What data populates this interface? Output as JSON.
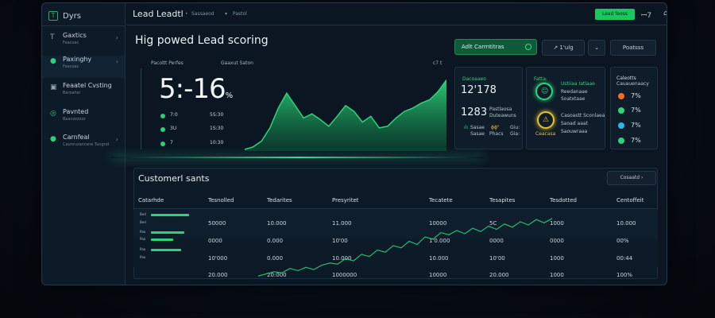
{
  "sidebar": {
    "brand": "Dyrs",
    "brand_icon": "T",
    "items": [
      {
        "label": "Gaxtics",
        "sub": "Feacoac",
        "icon": "T"
      },
      {
        "label": "Paxinghy",
        "sub": "Feacoac",
        "icon": "●"
      },
      {
        "label": "Feaatel Cvsting",
        "sub": "Baroahsr",
        "icon": "▣"
      },
      {
        "label": "Pavnted",
        "sub": "Baanzzzzzz",
        "icon": "◎"
      },
      {
        "label": "Carnfeal",
        "sub": "Caunruzanrane Tungnd",
        "icon": "●"
      }
    ]
  },
  "topbar": {
    "title": "Lead Leadtl",
    "crumb1": "Sassaeod",
    "crumb2": "Pastol",
    "action_button": "Lead feoss",
    "icon_labels": [
      "ꟷ7",
      "⌂",
      "⚙"
    ]
  },
  "main": {
    "title": "Hig powed Lead scoring",
    "btn_primary": "Adlt Carrntitras",
    "btn_secondary": "↗ 1'ulg",
    "btn_chevron": "⌄",
    "btn_options": "Poatsss"
  },
  "stats": {
    "label_left": "Pacoltt Perfes",
    "label_mid": "Gaaxut Saton",
    "label_right": "c7 t",
    "big_value": "5:-16",
    "big_unit": "%",
    "rows": [
      {
        "label": "7:0",
        "value": "5S:30"
      },
      {
        "label": "3U",
        "value": "1S:30"
      },
      {
        "label": "7",
        "value": "10:30"
      }
    ]
  },
  "chart_data": {
    "type": "area",
    "x": [
      0,
      1,
      2,
      3,
      4,
      5,
      6,
      7,
      8,
      9,
      10,
      11,
      12,
      13,
      14,
      15,
      16,
      17,
      18,
      19,
      20,
      21,
      22,
      23,
      24
    ],
    "series": [
      {
        "values": [
          2,
          5,
          12,
          28,
          52,
          70,
          55,
          40,
          45,
          38,
          30,
          42,
          55,
          48,
          35,
          42,
          28,
          30,
          40,
          48,
          52,
          58,
          62,
          72,
          86
        ]
      }
    ],
    "ylim": [
      0,
      100
    ],
    "color": "#2fd37a"
  },
  "panel_score": {
    "label": "Dacoaaeo",
    "big": "12'178",
    "label2": "Pastlaosa",
    "big2": "1283",
    "sub2": "Duteawuns",
    "row_labels": [
      "Sasae",
      "ɸɸ\"",
      "Giu:"
    ],
    "row_vals": [
      "Sasae",
      "Phacs",
      "Gia:"
    ]
  },
  "panel_gauge": {
    "label_top": "Fatta:",
    "icon1": "☺",
    "text1a": "Ustiiaa Iatlaae",
    "text1b": "Reedanaae",
    "text1c": "Soatxtaae",
    "icon2": "⚠",
    "text2a": "Casoastt Sconlaea",
    "text2b": "Saoad aaat",
    "text2c": "Saouwraaa",
    "stamp": "Ceacasa"
  },
  "panel_legend": {
    "title": "Caleotts",
    "subtitle": "Cauauenaacy",
    "items": [
      {
        "value": "7%",
        "color": "#f26b2b"
      },
      {
        "value": "7%",
        "color": "#2fd37a"
      },
      {
        "value": "7%",
        "color": "#29b8f0"
      },
      {
        "value": "7%",
        "color": "#2fd37a"
      }
    ]
  },
  "table": {
    "title": "Customerl sants",
    "filter": "Cosaatd",
    "headers": [
      "Catarhde",
      "Tesnolled",
      "Tedarites",
      "Presyritet",
      "Tecatete",
      "Tesapites",
      "Tesdotted",
      "Centoffeit"
    ],
    "rows": [
      {
        "cells": [
          "50000",
          "10.000",
          "11.000",
          "10000",
          "5C",
          "1000",
          "10.000"
        ],
        "mini": [
          [
            "Bed",
            48
          ],
          [
            "Bed",
            0
          ]
        ]
      },
      {
        "cells": [
          "0000",
          "0.000",
          "10'00",
          "1'0.000",
          "0000",
          "0000",
          "00%"
        ],
        "mini": [
          [
            "Paa",
            42
          ],
          [
            "Paa",
            28
          ]
        ]
      },
      {
        "cells": [
          "10'000",
          "0.000",
          "10.000",
          "10.000",
          "10'00",
          "1000",
          "00:44"
        ],
        "mini": [
          [
            "Paa",
            38
          ],
          [
            "Paa",
            0
          ]
        ]
      },
      {
        "cells": [
          "20.000",
          "20:000",
          "1000000",
          "10000",
          "20.000",
          "1000",
          "100%"
        ],
        "mini": [
          [
            "",
            0
          ],
          [
            "",
            0
          ]
        ]
      }
    ],
    "overlay_line": [
      2,
      4,
      6,
      5,
      9,
      7,
      10,
      8,
      12,
      14,
      13,
      18,
      16,
      22,
      20,
      26,
      24,
      30,
      28,
      34,
      31,
      38,
      36,
      42,
      40,
      44,
      41,
      46,
      43,
      48,
      45,
      50,
      47,
      52,
      49,
      54,
      51,
      55
    ],
    "overlay_ylim": [
      0,
      60
    ]
  }
}
